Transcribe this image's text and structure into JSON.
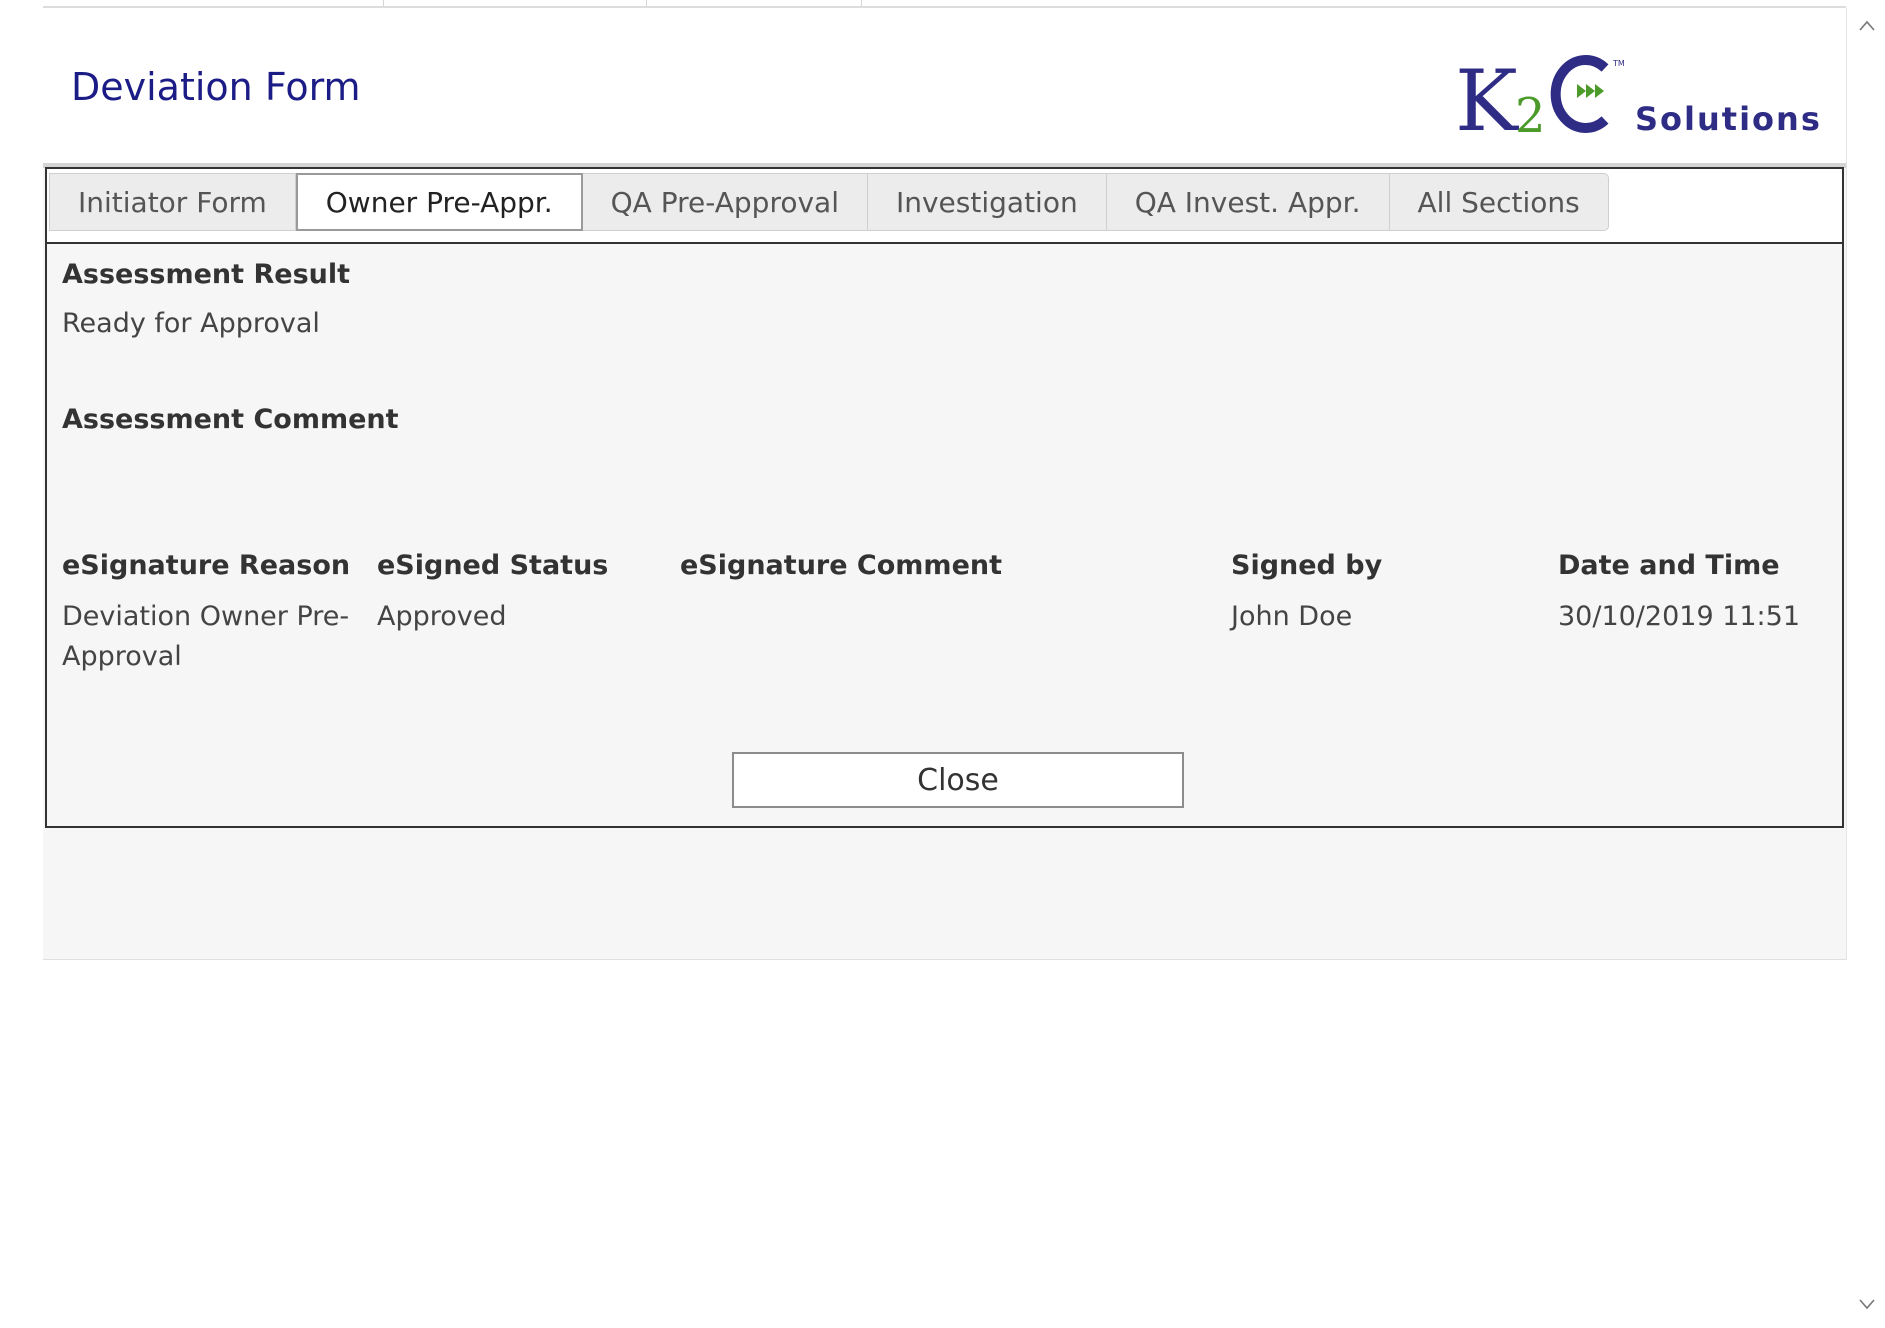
{
  "header": {
    "title": "Deviation Form",
    "logo": {
      "brand": "K2C",
      "tagline": "Solutions",
      "colors": {
        "primary": "#2f2c86",
        "accent": "#4c9a2a"
      }
    }
  },
  "tabs": [
    {
      "label": "Initiator Form",
      "active": false
    },
    {
      "label": "Owner Pre-Appr.",
      "active": true
    },
    {
      "label": "QA Pre-Approval",
      "active": false
    },
    {
      "label": "Investigation",
      "active": false
    },
    {
      "label": "QA Invest. Appr.",
      "active": false
    },
    {
      "label": "All Sections",
      "active": false
    }
  ],
  "assessment": {
    "result_label": "Assessment Result",
    "result_value": "Ready for Approval",
    "comment_label": "Assessment Comment",
    "comment_value": ""
  },
  "esignature": {
    "headers": {
      "reason": "eSignature Reason",
      "status": "eSigned Status",
      "comment": "eSignature Comment",
      "signed_by": "Signed by",
      "datetime": "Date and Time"
    },
    "row": {
      "reason": "Deviation Owner Pre-Approval",
      "status": "Approved",
      "comment": "",
      "signed_by": "John Doe",
      "datetime": "30/10/2019 11:51"
    }
  },
  "actions": {
    "close_label": "Close"
  },
  "colors": {
    "title": "#1c1c86",
    "panel_background": "#f6f6f6",
    "panel_border": "#333333"
  },
  "icons": {
    "scroll_up": "chevron-up-icon",
    "scroll_down": "chevron-down-icon"
  }
}
